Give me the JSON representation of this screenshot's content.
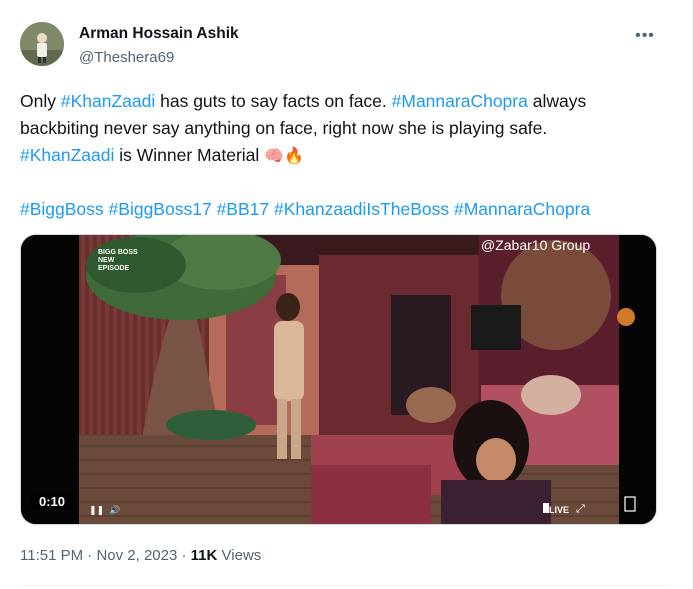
{
  "author": {
    "display_name": "Arman Hossain Ashik",
    "handle": "@Theshera69",
    "avatar_icon": "profile-photo"
  },
  "menu": {
    "more_label": "•••"
  },
  "tweet": {
    "line1": {
      "t1": "Only ",
      "h1": "#KhanZaadi",
      "t2": " has guts to say facts on face. ",
      "h2": "#MannaraChopra",
      "t3": " always"
    },
    "line2": {
      "t1": "backbiting never say anything on face, right now she is playing safe."
    },
    "line3": {
      "h1": "#KhanZaadi",
      "t1": " is Winner Material ",
      "emoji1": "🧠",
      "emoji2": "🔥"
    },
    "hashtags": {
      "h1": "#BiggBoss",
      "h2": "#BiggBoss17",
      "h3": "#BB17",
      "h4": "#KhanzaadiIsTheBoss",
      "h5": "#MannaraChopra"
    }
  },
  "video": {
    "watermark": "@Zabar10 Group",
    "logo_line1": "Bigg Boss",
    "logo_line2": "New",
    "logo_line3": "Episode",
    "time": "0:10",
    "live_label": "LIVE",
    "colors": {
      "set_wall": "#8a3e44",
      "floor": "#6a4a3a",
      "sofa": "#a1414f"
    }
  },
  "meta": {
    "time": "11:51 PM",
    "sep1": " · ",
    "date": "Nov 2, 2023",
    "sep2": " · ",
    "views_count": "11K",
    "views_label": " Views"
  },
  "colors": {
    "link": "#1d9bf0",
    "text": "#0f1419",
    "muted": "#536471"
  }
}
